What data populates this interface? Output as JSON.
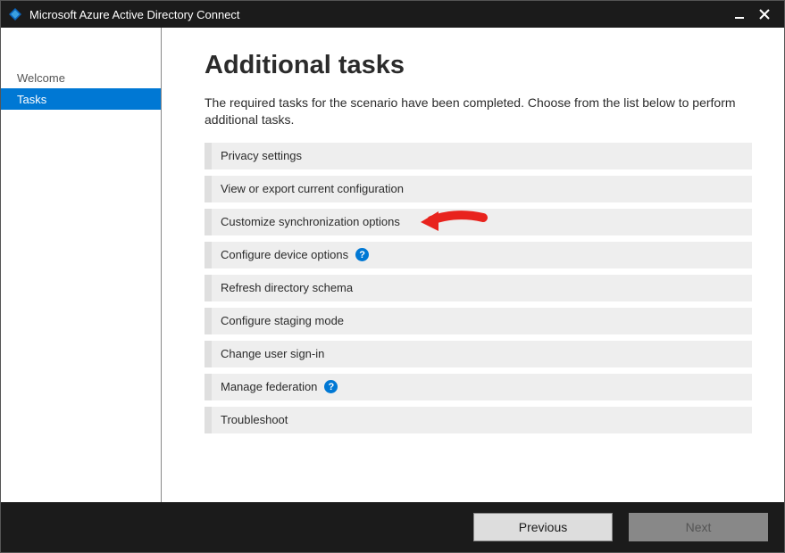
{
  "window": {
    "title": "Microsoft Azure Active Directory Connect"
  },
  "sidebar": {
    "items": [
      {
        "label": "Welcome",
        "active": false
      },
      {
        "label": "Tasks",
        "active": true
      }
    ]
  },
  "main": {
    "title": "Additional tasks",
    "description": "The required tasks for the scenario have been completed. Choose from the list below to perform additional tasks.",
    "tasks": [
      {
        "label": "Privacy settings",
        "help": false
      },
      {
        "label": "View or export current configuration",
        "help": false
      },
      {
        "label": "Customize synchronization options",
        "help": false
      },
      {
        "label": "Configure device options",
        "help": true
      },
      {
        "label": "Refresh directory schema",
        "help": false
      },
      {
        "label": "Configure staging mode",
        "help": false
      },
      {
        "label": "Change user sign-in",
        "help": false
      },
      {
        "label": "Manage federation",
        "help": true
      },
      {
        "label": "Troubleshoot",
        "help": false
      }
    ]
  },
  "footer": {
    "previous": "Previous",
    "next": "Next"
  },
  "annotation": {
    "arrow_target_index": 2
  }
}
